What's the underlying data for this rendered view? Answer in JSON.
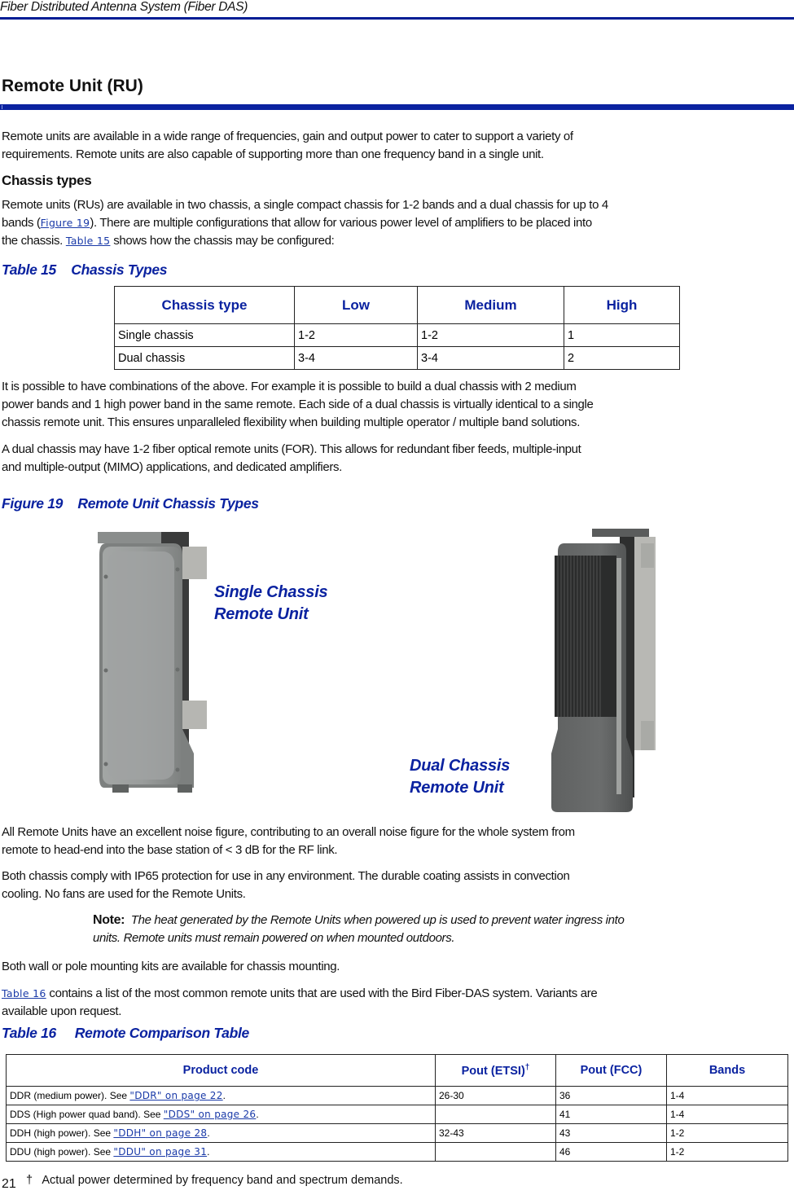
{
  "header": {
    "running_title": "Fiber Distributed Antenna System (Fiber DAS)"
  },
  "colors": {
    "accent": "#0a22a0",
    "header_rule": "#001c94",
    "link": "#1a3aa8",
    "single_chassis_body": "#8e9190",
    "dual_chassis_body": "#5a5c5c"
  },
  "section": {
    "title": "Remote Unit (RU)",
    "intro_line1": "Remote units are available in a wide range of frequencies, gain and output power to cater to support a variety of",
    "intro_line2": "requirements. Remote units are also capable of supporting more than one frequency band in a single unit.",
    "subheading": "Chassis types",
    "chassis_p1_line1": "Remote units (RUs) are available in two chassis, a single compact chassis for 1-2 bands and a dual chassis for up to 4",
    "chassis_p1_line2_pre": "bands (",
    "chassis_p1_line2_link": "Figure 19",
    "chassis_p1_line2_post": "). There are multiple configurations that allow for various power level of amplifiers to be placed into",
    "chassis_p1_line3_pre": "the chassis. ",
    "chassis_p1_line3_link": "Table 15",
    "chassis_p1_line3_post": " shows how the chassis may be configured:"
  },
  "table15": {
    "caption": "Table 15    Chassis Types",
    "headers": [
      "Chassis type",
      "Low",
      "Medium",
      "High"
    ],
    "rows": [
      [
        "Single chassis",
        "1-2",
        "1-2",
        "1"
      ],
      [
        "Dual chassis",
        "3-4",
        "3-4",
        "2"
      ]
    ]
  },
  "combinations": {
    "line1": "It is possible to have combinations of the above. For example it is possible to build a dual chassis with 2 medium",
    "line2": "power bands and 1 high power band in the same remote. Each side of a dual chassis is virtually identical to a single",
    "line3": "chassis remote unit. This ensures unparalleled flexibility when building multiple operator / multiple band solutions.",
    "for_line1": "A dual chassis may have 1-2 fiber optical remote units (FOR). This allows for redundant fiber feeds, multiple-input",
    "for_line2": "and multiple-output (MIMO) applications, and dedicated amplifiers."
  },
  "figure19": {
    "caption": "Figure 19    Remote Unit Chassis Types",
    "single_label_line1": "Single Chassis",
    "single_label_line2": "Remote Unit",
    "dual_label_line1": "Dual Chassis",
    "dual_label_line2": "Remote Unit"
  },
  "after_figure": {
    "noise_line1": "All Remote Units have an excellent noise figure, contributing to an overall noise figure for the whole system from",
    "noise_line2": "remote to head-end into the base station of < 3 dB for the RF link.",
    "ip65_line1": "Both chassis comply with IP65 protection for use in any environment. The durable coating assists in convection",
    "ip65_line2": "cooling. No fans are used for the Remote Units.",
    "note_label": "Note:",
    "note_line1": "The heat generated by the Remote Units when powered up is used to prevent water ingress into",
    "note_line2": "units. Remote units must remain powered on when mounted outdoors.",
    "mounting": "Both wall or pole mounting kits are available for chassis mounting.",
    "t16_intro_link": "Table 16",
    "t16_intro_line1_post": " contains a list of the most common remote units that are used with the Bird Fiber-DAS system. Variants are",
    "t16_intro_line2": "available upon request."
  },
  "table16": {
    "caption": "Table 16     Remote Comparison Table",
    "headers": [
      "Product code",
      "Pout (ETSI)",
      "Pout (FCC)",
      "Bands"
    ],
    "etsi_marker": "†",
    "rows": [
      {
        "code_pre": "DDR (medium power). See ",
        "link": "\"DDR\" on page 22",
        "code_post": ".",
        "etsi": "26-30",
        "fcc": "36",
        "bands": "1-4"
      },
      {
        "code_pre": "DDS (High power quad band). See ",
        "link": "\"DDS\" on page 26",
        "code_post": ".",
        "etsi": "",
        "fcc": "41",
        "bands": "1-4"
      },
      {
        "code_pre": "DDH (high power). See ",
        "link": "\"DDH\" on page 28",
        "code_post": ".",
        "etsi": "32-43",
        "fcc": "43",
        "bands": "1-2"
      },
      {
        "code_pre": "DDU (high power). See ",
        "link": "\"DDU\" on page 31",
        "code_post": ".",
        "etsi": "",
        "fcc": "46",
        "bands": "1-2"
      }
    ]
  },
  "footer": {
    "page_number": "21",
    "footnote_marker": "†",
    "footnote_text": "Actual power determined by frequency band and spectrum demands."
  }
}
